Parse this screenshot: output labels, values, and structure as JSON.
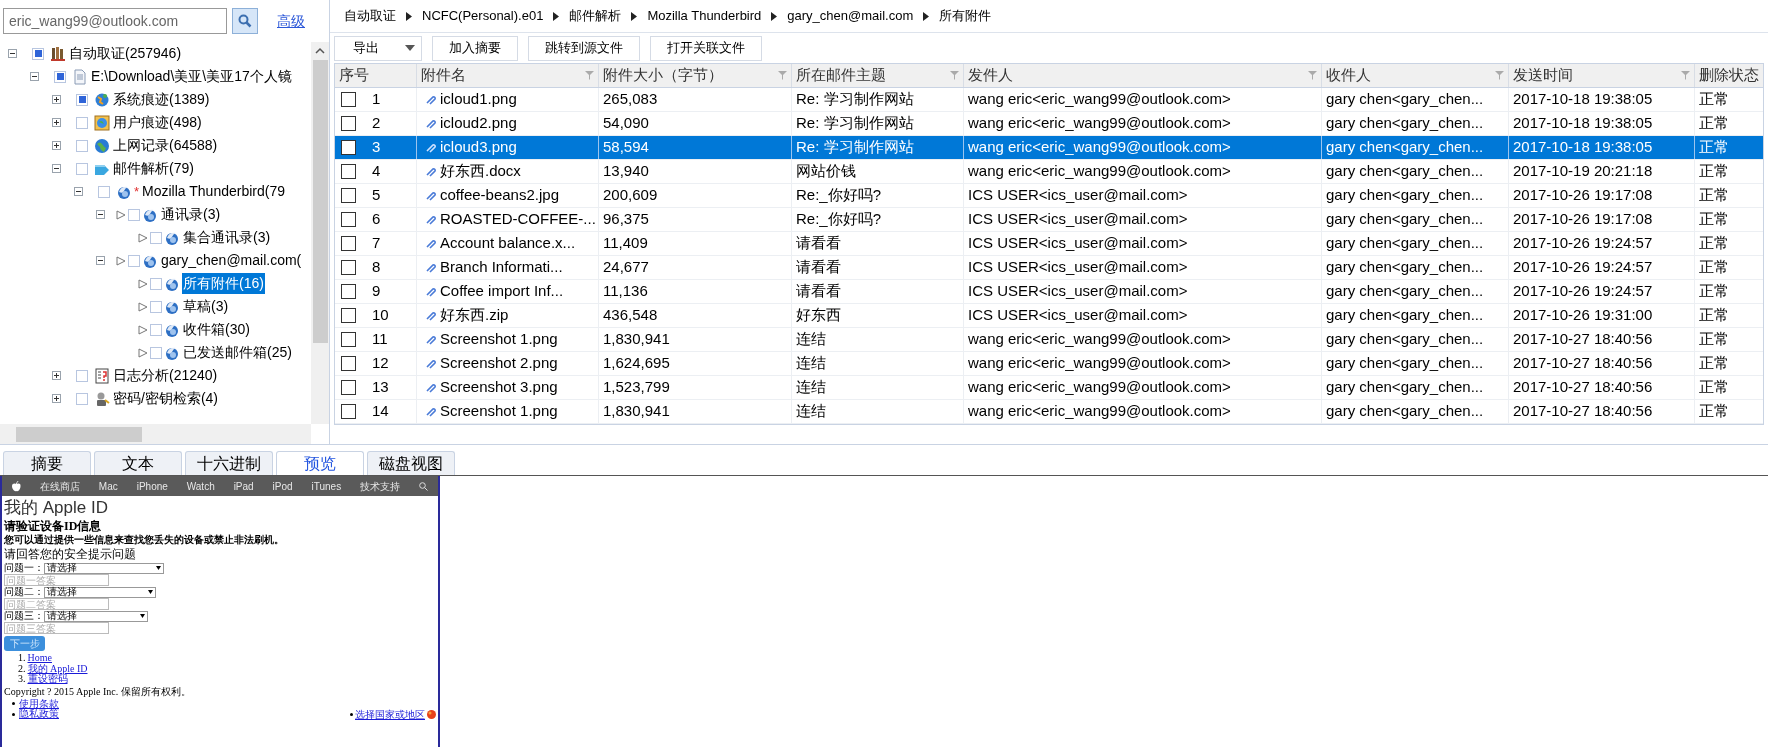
{
  "search": {
    "value": "eric_wang99@outlook.com",
    "advanced_link": "高级"
  },
  "tree": [
    {
      "label": "自动取证(257946)",
      "kind": "case",
      "checked": true,
      "expanded": true,
      "children": [
        {
          "label": "E:\\Download\\美亚\\美亚17个人镜",
          "kind": "file",
          "checked": true,
          "expanded": true,
          "children": [
            {
              "label": "系统痕迹(1389)",
              "kind": "system",
              "checked": true,
              "expanded": false
            },
            {
              "label": "用户痕迹(498)",
              "kind": "user",
              "checked": false,
              "expanded": false
            },
            {
              "label": "上网记录(64588)",
              "kind": "web",
              "checked": false,
              "expanded": false
            },
            {
              "label": "邮件解析(79)",
              "kind": "mail",
              "checked": false,
              "expanded": true,
              "children": [
                {
                  "label": "Mozilla Thunderbird(79",
                  "marker": "*",
                  "kind": "thunderbird",
                  "checked": false,
                  "expanded": true,
                  "children": [
                    {
                      "label": "通讯录(3)",
                      "kind": "folder",
                      "checked": false,
                      "expanded": true,
                      "children": [
                        {
                          "label": "集合通讯录(3)",
                          "kind": "folder",
                          "checked": false,
                          "selected": false
                        }
                      ]
                    },
                    {
                      "label": "gary_chen@mail.com(",
                      "kind": "folder",
                      "checked": false,
                      "expanded": true,
                      "children": [
                        {
                          "label": "所有附件(16)",
                          "kind": "folder",
                          "checked": false,
                          "selected": true
                        },
                        {
                          "label": "草稿(3)",
                          "kind": "folder",
                          "checked": false,
                          "selected": false
                        },
                        {
                          "label": "收件箱(30)",
                          "kind": "folder",
                          "checked": false,
                          "selected": false
                        },
                        {
                          "label": "已发送邮件箱(25)",
                          "kind": "folder",
                          "checked": false,
                          "selected": false
                        }
                      ]
                    }
                  ]
                }
              ]
            },
            {
              "label": "日志分析(21240)",
              "kind": "log",
              "checked": false,
              "expanded": false
            },
            {
              "label": "密码/密钥检索(4)",
              "kind": "password",
              "checked": false,
              "expanded": false
            }
          ]
        }
      ]
    }
  ],
  "breadcrumb": [
    "自动取证",
    "NCFC(Personal).e01",
    "邮件解析",
    "Mozilla Thunderbird",
    "gary_chen@mail.com",
    "所有附件"
  ],
  "toolbar": [
    {
      "label": "导出",
      "kind": "dropdown"
    },
    {
      "label": "加入摘要",
      "kind": "button"
    },
    {
      "label": "跳转到源文件",
      "kind": "button"
    },
    {
      "label": "打开关联文件",
      "kind": "button"
    }
  ],
  "table": {
    "columns": [
      {
        "label": "序号",
        "filter": false
      },
      {
        "label": "附件名",
        "filter": true
      },
      {
        "label": "附件大小（字节）",
        "filter": true
      },
      {
        "label": "所在邮件主题",
        "filter": true
      },
      {
        "label": "发件人",
        "filter": true
      },
      {
        "label": "收件人",
        "filter": true
      },
      {
        "label": "发送时间",
        "filter": true
      },
      {
        "label": "删除状态",
        "filter": false
      }
    ],
    "rows": [
      {
        "checked": false,
        "selected": false,
        "cells": [
          "1",
          "icloud1.png",
          "265,083",
          "Re: 学习制作网站",
          "wang eric<eric_wang99@outlook.com>",
          "gary chen<gary_chen...",
          "2017-10-18 19:38:05",
          "正常"
        ]
      },
      {
        "checked": false,
        "selected": false,
        "cells": [
          "2",
          "icloud2.png",
          "54,090",
          "Re: 学习制作网站",
          "wang eric<eric_wang99@outlook.com>",
          "gary chen<gary_chen...",
          "2017-10-18 19:38:05",
          "正常"
        ]
      },
      {
        "checked": false,
        "selected": true,
        "cells": [
          "3",
          "icloud3.png",
          "58,594",
          "Re: 学习制作网站",
          "wang eric<eric_wang99@outlook.com>",
          "gary chen<gary_chen...",
          "2017-10-18 19:38:05",
          "正常"
        ]
      },
      {
        "checked": false,
        "selected": false,
        "cells": [
          "4",
          "好东西.docx",
          "13,940",
          "网站价钱",
          "wang eric<eric_wang99@outlook.com>",
          "gary chen<gary_chen...",
          "2017-10-19 20:21:18",
          "正常"
        ]
      },
      {
        "checked": false,
        "selected": false,
        "cells": [
          "5",
          "coffee-beans2.jpg",
          "200,609",
          "Re:_你好吗?",
          "ICS USER<ics_user@mail.com>",
          "gary chen<gary_chen...",
          "2017-10-26 19:17:08",
          "正常"
        ]
      },
      {
        "checked": false,
        "selected": false,
        "cells": [
          "6",
          "ROASTED-COFFEE-...",
          "96,375",
          "Re:_你好吗?",
          "ICS USER<ics_user@mail.com>",
          "gary chen<gary_chen...",
          "2017-10-26 19:17:08",
          "正常"
        ]
      },
      {
        "checked": false,
        "selected": false,
        "cells": [
          "7",
          "Account balance.x...",
          "11,409",
          "请看看",
          "ICS USER<ics_user@mail.com>",
          "gary chen<gary_chen...",
          "2017-10-26 19:24:57",
          "正常"
        ]
      },
      {
        "checked": false,
        "selected": false,
        "cells": [
          "8",
          "Branch Informati...",
          "24,677",
          "请看看",
          "ICS USER<ics_user@mail.com>",
          "gary chen<gary_chen...",
          "2017-10-26 19:24:57",
          "正常"
        ]
      },
      {
        "checked": false,
        "selected": false,
        "cells": [
          "9",
          "Coffee import Inf...",
          "11,136",
          "请看看",
          "ICS USER<ics_user@mail.com>",
          "gary chen<gary_chen...",
          "2017-10-26 19:24:57",
          "正常"
        ]
      },
      {
        "checked": false,
        "selected": false,
        "cells": [
          "10",
          "好东西.zip",
          "436,548",
          "好东西",
          "ICS USER<ics_user@mail.com>",
          "gary chen<gary_chen...",
          "2017-10-26 19:31:00",
          "正常"
        ]
      },
      {
        "checked": false,
        "selected": false,
        "cells": [
          "11",
          "Screenshot 1.png",
          "1,830,941",
          "连结",
          "wang eric<eric_wang99@outlook.com>",
          "gary chen<gary_chen...",
          "2017-10-27 18:40:56",
          "正常"
        ]
      },
      {
        "checked": false,
        "selected": false,
        "cells": [
          "12",
          "Screenshot 2.png",
          "1,624,695",
          "连结",
          "wang eric<eric_wang99@outlook.com>",
          "gary chen<gary_chen...",
          "2017-10-27 18:40:56",
          "正常"
        ]
      },
      {
        "checked": false,
        "selected": false,
        "cells": [
          "13",
          "Screenshot 3.png",
          "1,523,799",
          "连结",
          "wang eric<eric_wang99@outlook.com>",
          "gary chen<gary_chen...",
          "2017-10-27 18:40:56",
          "正常"
        ]
      },
      {
        "checked": false,
        "selected": false,
        "cells": [
          "14",
          "Screenshot 1.png",
          "1,830,941",
          "连结",
          "wang eric<eric_wang99@outlook.com>",
          "gary chen<gary_chen...",
          "2017-10-27 18:40:56",
          "正常"
        ]
      }
    ]
  },
  "bottom_tabs": [
    {
      "label": "摘要",
      "selected": false
    },
    {
      "label": "文本",
      "selected": false
    },
    {
      "label": "十六进制",
      "selected": false
    },
    {
      "label": "预览",
      "selected": true
    },
    {
      "label": "磁盘视图",
      "selected": false
    }
  ],
  "preview": {
    "nav": [
      "在线商店",
      "Mac",
      "iPhone",
      "Watch",
      "iPad",
      "iPod",
      "iTunes",
      "技术支持"
    ],
    "title": "我的 Apple ID",
    "heading": "请验证设备ID信息",
    "intro": "您可以通过提供一些信息来查找您丢失的设备或禁止非法刷机。",
    "question_heading": "请回答您的安全提示问题",
    "questions": [
      {
        "label": "问题一：",
        "select": "请选择",
        "answer_placeholder": "问题一答案"
      },
      {
        "label": "问题二：",
        "select": "请选择",
        "answer_placeholder": "问题二答案"
      },
      {
        "label": "问题三：",
        "select": "请选择",
        "answer_placeholder": "问题三答案"
      }
    ],
    "next_button": "下一步",
    "crumbs": [
      {
        "number": "1.",
        "label": "Home"
      },
      {
        "number": "2.",
        "label": "我的 Apple ID"
      },
      {
        "number": "3.",
        "label": "重设密码"
      }
    ],
    "copyright": "Copyright ? 2015 Apple Inc. 保留所有权利。",
    "footer_links": [
      "使用条款",
      "隐私政策"
    ],
    "country_link": "选择国家或地区"
  }
}
